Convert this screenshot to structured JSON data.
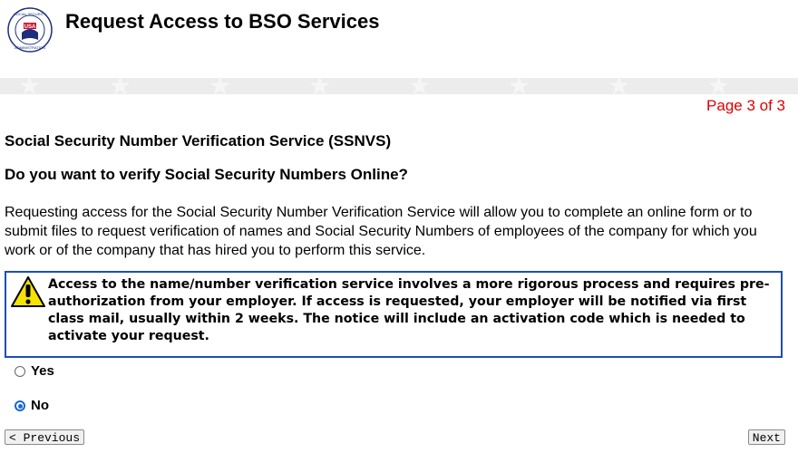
{
  "header": {
    "title": "Request Access to BSO Services",
    "seal_text_top": "SOCIAL SECURITY",
    "seal_text_mid": "USA",
    "seal_text_bottom": "ADMINISTRATION"
  },
  "page_indicator": "Page 3 of 3",
  "section_title": "Social Security Number Verification Service (SSNVS)",
  "question": "Do you want to verify Social Security Numbers Online?",
  "description": "Requesting access for the Social Security Number Verification Service will allow you to complete an online form or to submit files to request verification of names and Social Security Numbers of employees of the company for which you work or of the company that has hired you to perform this service.",
  "warning": {
    "icon": "warning-icon",
    "text": "Access to the name/number verification service involves a more rigorous process and requires pre-authorization from your employer. If access is requested, your employer will be notified via first class mail, usually within 2 weeks. The notice will include an activation code which is needed to activate your request."
  },
  "options": [
    {
      "label": "Yes",
      "selected": false
    },
    {
      "label": "No",
      "selected": true
    }
  ],
  "nav": {
    "previous_label": "< Previous",
    "next_label": "Next"
  },
  "colors": {
    "page_indicator": "#e00000",
    "warning_border": "#1c4fb0",
    "warning_icon": "#f5e200",
    "radio_selected": "#1a66d4"
  }
}
